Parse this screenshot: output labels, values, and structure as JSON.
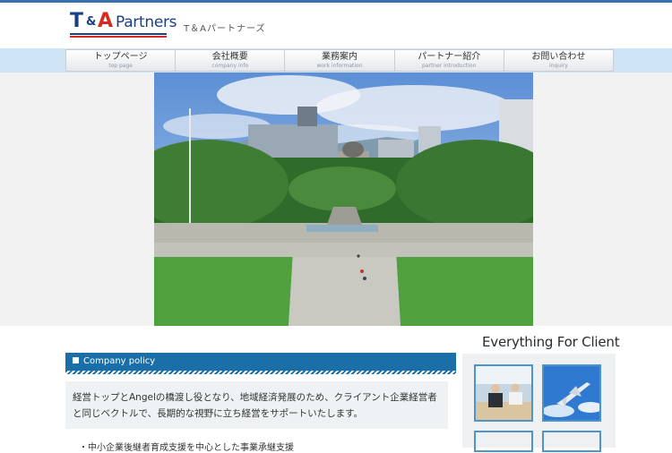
{
  "header": {
    "logo_t": "T",
    "logo_amp": "&",
    "logo_a": "A",
    "logo_partners": "Partners",
    "company_name_jp": "T＆Aパートナーズ"
  },
  "nav": {
    "items": [
      {
        "label": "トップページ",
        "sub": "top page"
      },
      {
        "label": "会社概要",
        "sub": "company info"
      },
      {
        "label": "業務案内",
        "sub": "work information"
      },
      {
        "label": "パートナー紹介",
        "sub": "partner introduction"
      },
      {
        "label": "お問い合わせ",
        "sub": "inquiry"
      }
    ]
  },
  "policy": {
    "heading": "Company policy",
    "text": "経営トップとAngelの橋渡し役となり、地域経済発展のため、クライアント企業経営者と同じベクトルで、長期的な視野に立ち経営をサポートいたします。",
    "bullet": "・中小企業後継者育成支援を中心とした事業承継支援"
  },
  "sidebar": {
    "title": "Everything For Client"
  },
  "colors": {
    "brand_blue": "#1b3f86",
    "brand_red": "#d42a1f",
    "accent_blue": "#1b6fa8",
    "nav_band": "#cfe5f5"
  }
}
